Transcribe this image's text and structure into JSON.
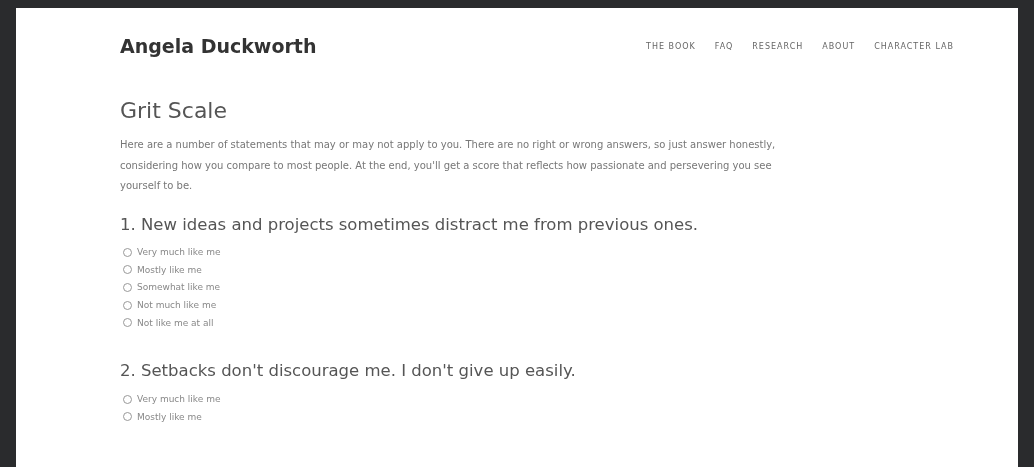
{
  "header": {
    "site_title": "Angela Duckworth",
    "nav": [
      {
        "label": "THE BOOK"
      },
      {
        "label": "FAQ"
      },
      {
        "label": "RESEARCH"
      },
      {
        "label": "ABOUT"
      },
      {
        "label": "CHARACTER LAB"
      }
    ]
  },
  "page": {
    "title": "Grit Scale",
    "intro": "Here are a number of statements that may or may not apply to you. There are no right or wrong answers, so just answer honestly, considering how you compare to most people. At the end, you'll get a score that reflects how passionate and persevering you see yourself to be.",
    "questions": [
      {
        "text": "1. New ideas and projects sometimes distract me from previous ones.",
        "options": [
          {
            "label": "Very much like me",
            "selected": false
          },
          {
            "label": "Mostly like me",
            "selected": false
          },
          {
            "label": "Somewhat like me",
            "selected": false
          },
          {
            "label": "Not much like me",
            "selected": false
          },
          {
            "label": "Not like me at all",
            "selected": false
          }
        ]
      },
      {
        "text": "2. Setbacks don't discourage me. I don't give up easily.",
        "options": [
          {
            "label": "Very much like me",
            "selected": false
          },
          {
            "label": "Mostly like me",
            "selected": false
          }
        ]
      }
    ]
  }
}
